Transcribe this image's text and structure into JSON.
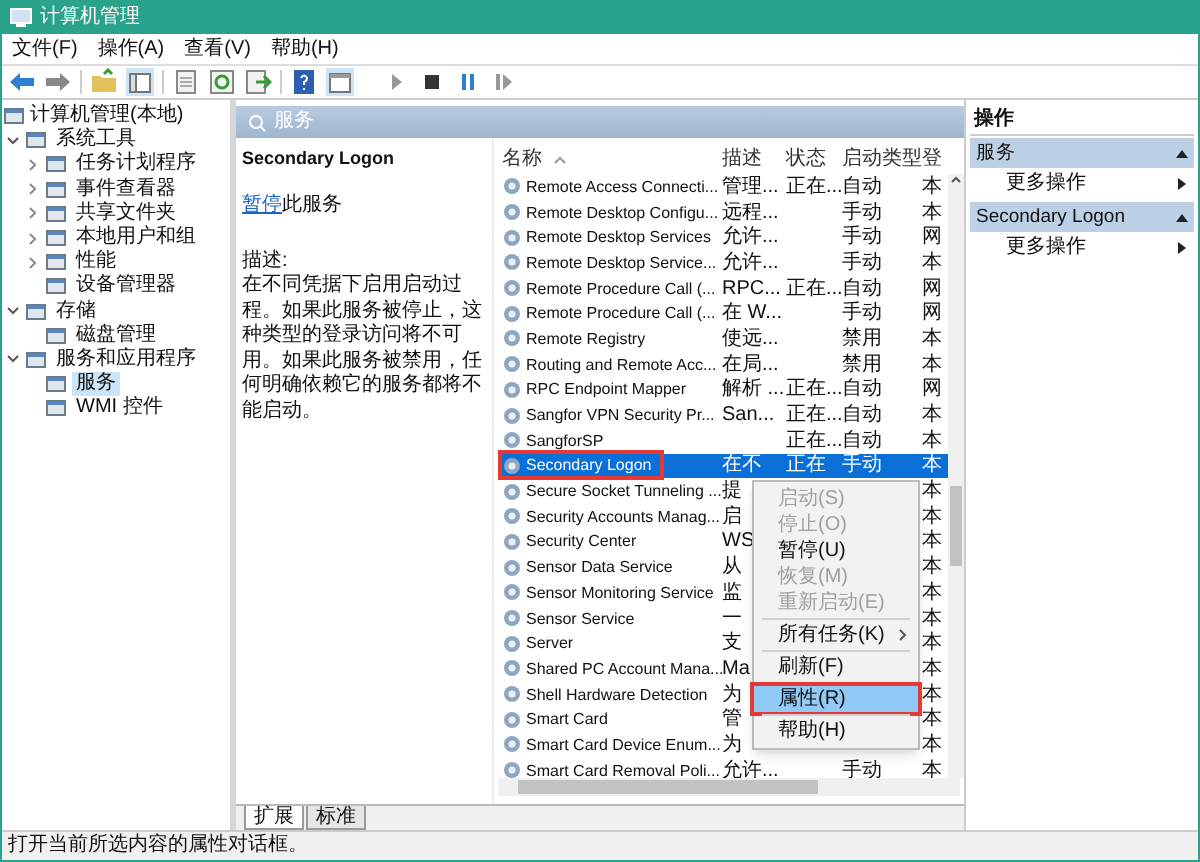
{
  "window": {
    "title": "计算机管理"
  },
  "menu_bar": [
    "文件(F)",
    "操作(A)",
    "查看(V)",
    "帮助(H)"
  ],
  "tree": [
    {
      "label": "计算机管理(本地)",
      "children": [
        {
          "label": "系统工具",
          "expanded": true,
          "selected": false,
          "children": [
            {
              "label": "任务计划程序",
              "expanded": false,
              "selected": false
            },
            {
              "label": "事件查看器",
              "expanded": false,
              "selected": false
            },
            {
              "label": "共享文件夹",
              "expanded": false,
              "selected": false
            },
            {
              "label": "本地用户和组",
              "expanded": false,
              "selected": false
            },
            {
              "label": "性能",
              "expanded": false,
              "selected": false
            },
            {
              "label": "设备管理器",
              "selected": false
            }
          ]
        },
        {
          "label": "存储",
          "expanded": true,
          "selected": false,
          "children": [
            {
              "label": "磁盘管理",
              "selected": false
            }
          ]
        },
        {
          "label": "服务和应用程序",
          "expanded": true,
          "selected": false,
          "children": [
            {
              "label": "服务",
              "selected": true
            },
            {
              "label": "WMI 控件",
              "selected": false
            }
          ]
        }
      ],
      "selected": false
    }
  ],
  "header": {
    "title": "服务"
  },
  "details": {
    "title": "Secondary Logon",
    "action_link": "暂停",
    "action_text": "此服务",
    "description_label": "描述:",
    "description": "在不同凭据下启用启动过程。如果此服务被停止，这种类型的登录访问将不可用。如果此服务被禁用，任何明确依赖它的服务都将不能启动。"
  },
  "table": {
    "columns": [
      "名称",
      "描述",
      "状态",
      "启动类型",
      "登"
    ],
    "rows": [
      {
        "name": "Remote Access Connecti...",
        "description": "管理...",
        "status": "正在...",
        "startup_type": "自动",
        "column_5": "本",
        "selected": false,
        "annotated": false
      },
      {
        "name": "Remote Desktop Configu...",
        "description": "远程...",
        "startup_type": "手动",
        "column_5": "本",
        "selected": false,
        "annotated": false
      },
      {
        "name": "Remote Desktop Services",
        "description": "允许...",
        "startup_type": "手动",
        "column_5": "网",
        "selected": false,
        "annotated": false
      },
      {
        "name": "Remote Desktop Service...",
        "description": "允许...",
        "startup_type": "手动",
        "column_5": "本",
        "selected": false,
        "annotated": false
      },
      {
        "name": "Remote Procedure Call (...",
        "description": "RPC...",
        "status": "正在...",
        "startup_type": "自动",
        "column_5": "网",
        "selected": false,
        "annotated": false
      },
      {
        "name": "Remote Procedure Call (...",
        "description": "在 W...",
        "startup_type": "手动",
        "column_5": "网",
        "selected": false,
        "annotated": false
      },
      {
        "name": "Remote Registry",
        "description": "使远...",
        "startup_type": "禁用",
        "column_5": "本",
        "selected": false,
        "annotated": false
      },
      {
        "name": "Routing and Remote Acc...",
        "description": "在局...",
        "startup_type": "禁用",
        "column_5": "本",
        "selected": false,
        "annotated": false
      },
      {
        "name": "RPC Endpoint Mapper",
        "description": "解析 ...",
        "status": "正在...",
        "startup_type": "自动",
        "column_5": "网",
        "selected": false,
        "annotated": false
      },
      {
        "name": "Sangfor VPN Security Pr...",
        "description": "San...",
        "status": "正在...",
        "startup_type": "自动",
        "column_5": "本",
        "selected": false,
        "annotated": false
      },
      {
        "name": "SangforSP",
        "status": "正在...",
        "startup_type": "自动",
        "column_5": "本",
        "selected": false,
        "annotated": false
      },
      {
        "name": "Secondary Logon",
        "description": "在不",
        "status": "正在",
        "startup_type": "手动",
        "column_5": "本",
        "selected": true,
        "annotated": true
      },
      {
        "name": "Secure Socket Tunneling ...",
        "description": "提",
        "column_5": "本",
        "selected": false,
        "annotated": false
      },
      {
        "name": "Security Accounts Manag...",
        "description": "启",
        "column_5": "本",
        "selected": false,
        "annotated": false
      },
      {
        "name": "Security Center",
        "description": "WS",
        "column_5": "本",
        "selected": false,
        "annotated": false
      },
      {
        "name": "Sensor Data Service",
        "description": "从",
        "column_5": "本",
        "selected": false,
        "annotated": false
      },
      {
        "name": "Sensor Monitoring Service",
        "description": "监",
        "column_5": "本",
        "selected": false,
        "annotated": false
      },
      {
        "name": "Sensor Service",
        "description": "一",
        "column_5": "本",
        "selected": false,
        "annotated": false
      },
      {
        "name": "Server",
        "description": "支",
        "column_5": "本",
        "selected": false,
        "annotated": false
      },
      {
        "name": "Shared PC Account Mana...",
        "description": "Ma",
        "column_5": "本",
        "selected": false,
        "annotated": false
      },
      {
        "name": "Shell Hardware Detection",
        "description": "为",
        "column_5": "本",
        "selected": false,
        "annotated": false
      },
      {
        "name": "Smart Card",
        "description": "管",
        "column_5": "本",
        "selected": false,
        "annotated": false
      },
      {
        "name": "Smart Card Device Enum...",
        "description": "为",
        "column_5": "本",
        "selected": false,
        "annotated": false
      },
      {
        "name": "Smart Card Removal Poli...",
        "description": "允许...",
        "startup_type": "手动",
        "column_5": "本",
        "selected": false,
        "annotated": false
      }
    ]
  },
  "context_menu": {
    "items": [
      {
        "kind": "item",
        "label": "启动(S)",
        "disabled": true,
        "highlighted": false,
        "annotated": false
      },
      {
        "kind": "item",
        "label": "停止(O)",
        "disabled": true,
        "highlighted": false,
        "annotated": false
      },
      {
        "kind": "item",
        "label": "暂停(U)",
        "disabled": false,
        "highlighted": false,
        "annotated": false
      },
      {
        "kind": "item",
        "label": "恢复(M)",
        "disabled": true,
        "highlighted": false,
        "annotated": false
      },
      {
        "kind": "item",
        "label": "重新启动(E)",
        "disabled": true,
        "highlighted": false,
        "annotated": false
      },
      {
        "kind": "separator"
      },
      {
        "kind": "submenu",
        "label": "所有任务(K)",
        "disabled": false,
        "highlighted": false,
        "annotated": false
      },
      {
        "kind": "separator"
      },
      {
        "kind": "item",
        "label": "刷新(F)",
        "disabled": false,
        "highlighted": false,
        "annotated": false
      },
      {
        "kind": "separator"
      },
      {
        "kind": "item",
        "label": "属性(R)",
        "disabled": false,
        "highlighted": true,
        "annotated": true
      },
      {
        "kind": "separator"
      },
      {
        "kind": "item",
        "label": "帮助(H)",
        "disabled": false,
        "highlighted": false,
        "annotated": false
      }
    ]
  },
  "bottom_tabs": [
    {
      "label": "扩展",
      "selected": true
    },
    {
      "label": "标准",
      "selected": false
    }
  ],
  "actions": {
    "title": "操作",
    "groups": [
      {
        "title": "服务",
        "items": [
          "更多操作"
        ]
      },
      {
        "title": "Secondary Logon",
        "items": [
          "更多操作"
        ]
      }
    ]
  },
  "status_bar": "打开当前所选内容的属性对话框。"
}
